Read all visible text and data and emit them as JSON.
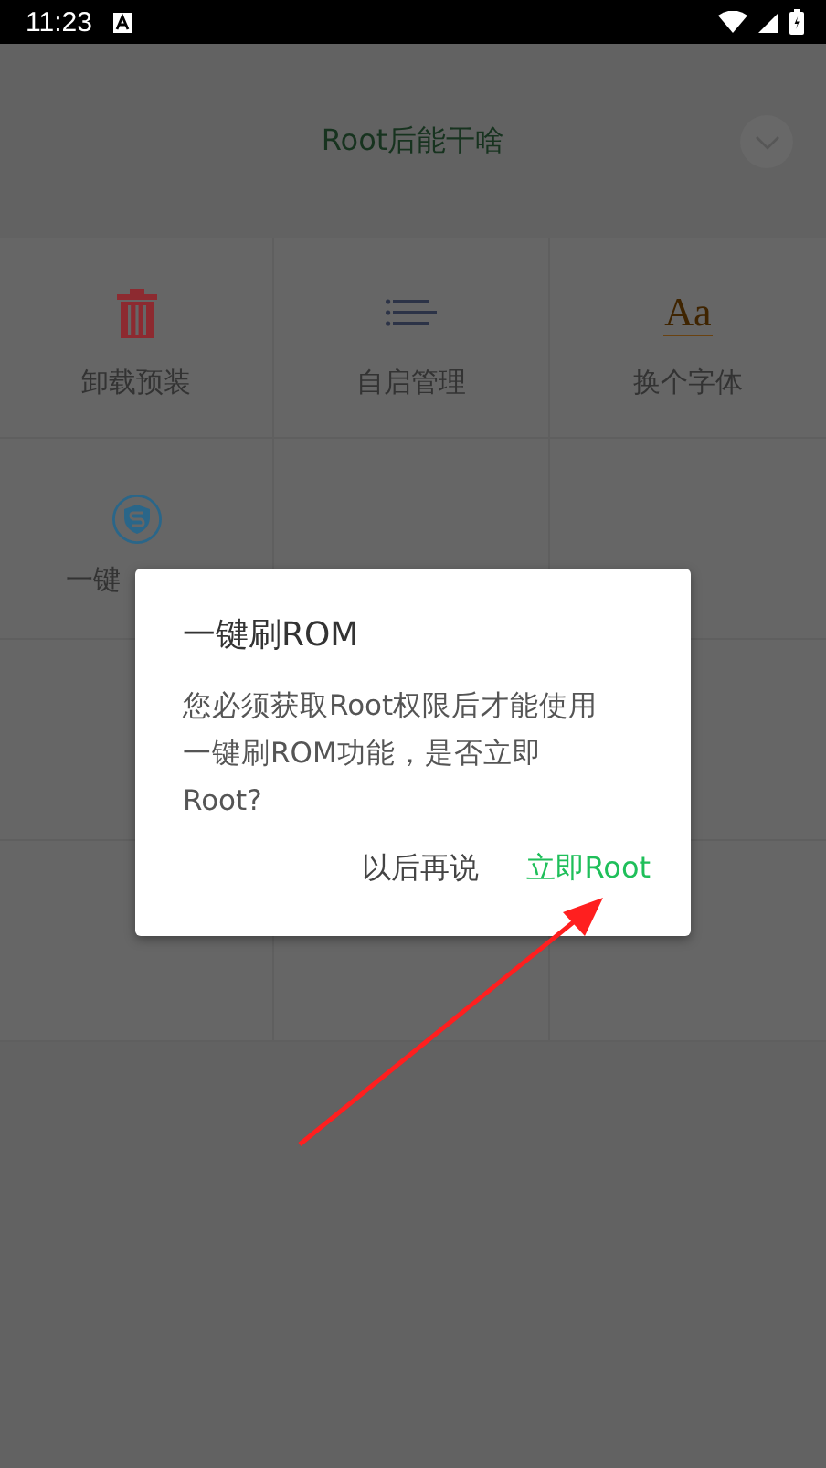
{
  "status_bar": {
    "time": "11:23"
  },
  "header": {
    "title": "Root后能干啥"
  },
  "grid": {
    "items": [
      {
        "kind": "trash",
        "label": "卸载预装"
      },
      {
        "kind": "list",
        "label": "自启管理"
      },
      {
        "kind": "font",
        "label": "换个字体",
        "icon_text": "Aa"
      },
      {
        "kind": "shield",
        "label": "一键"
      }
    ]
  },
  "dialog": {
    "title": "一键刷ROM",
    "message": "您必须获取Root权限后才能使用一键刷ROM功能，是否立即Root?",
    "buttons": [
      {
        "label": "以后再说",
        "primary": false
      },
      {
        "label": "立即Root",
        "primary": true
      }
    ]
  }
}
